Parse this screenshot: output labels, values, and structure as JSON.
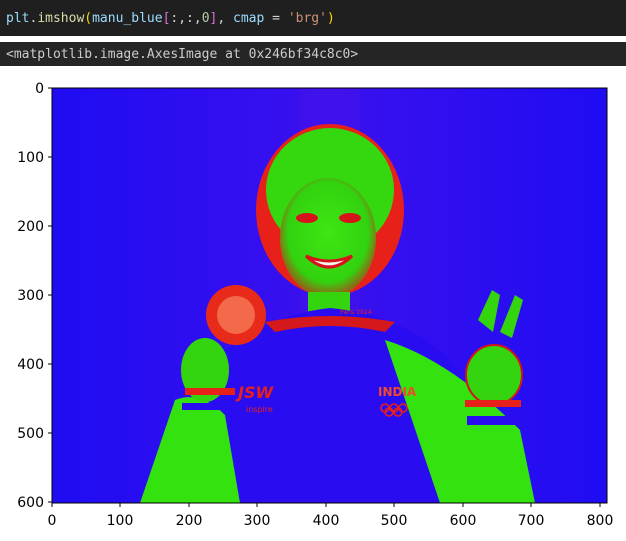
{
  "notebook": {
    "code_cell": {
      "obj": "plt",
      "dot": ".",
      "fn": "imshow",
      "open_paren": "(",
      "arg_name": "manu_blue",
      "open_bracket": "[",
      "slice_text": ":,:,",
      "index": "0",
      "close_bracket": "]",
      "comma": ", ",
      "kw": "cmap",
      "eq": " = ",
      "cmap_value": "'brg'",
      "close_paren": ")"
    },
    "output_text": "<matplotlib.image.AxesImage at 0x246bf34c8c0>"
  },
  "plot": {
    "image_description_colors": {
      "background": "#2e0bf0",
      "figure": "#35e00f",
      "accent": "#f01a1a"
    },
    "x_ticks": [
      "0",
      "100",
      "200",
      "300",
      "400",
      "500",
      "600",
      "700",
      "800"
    ],
    "y_ticks": [
      "0",
      "100",
      "200",
      "300",
      "400",
      "500",
      "600"
    ],
    "overlay_texts": {
      "sponsor": "JSW",
      "sponsor_sub": "inspire",
      "country": "INDIA",
      "collar": "Paris 2024"
    }
  }
}
